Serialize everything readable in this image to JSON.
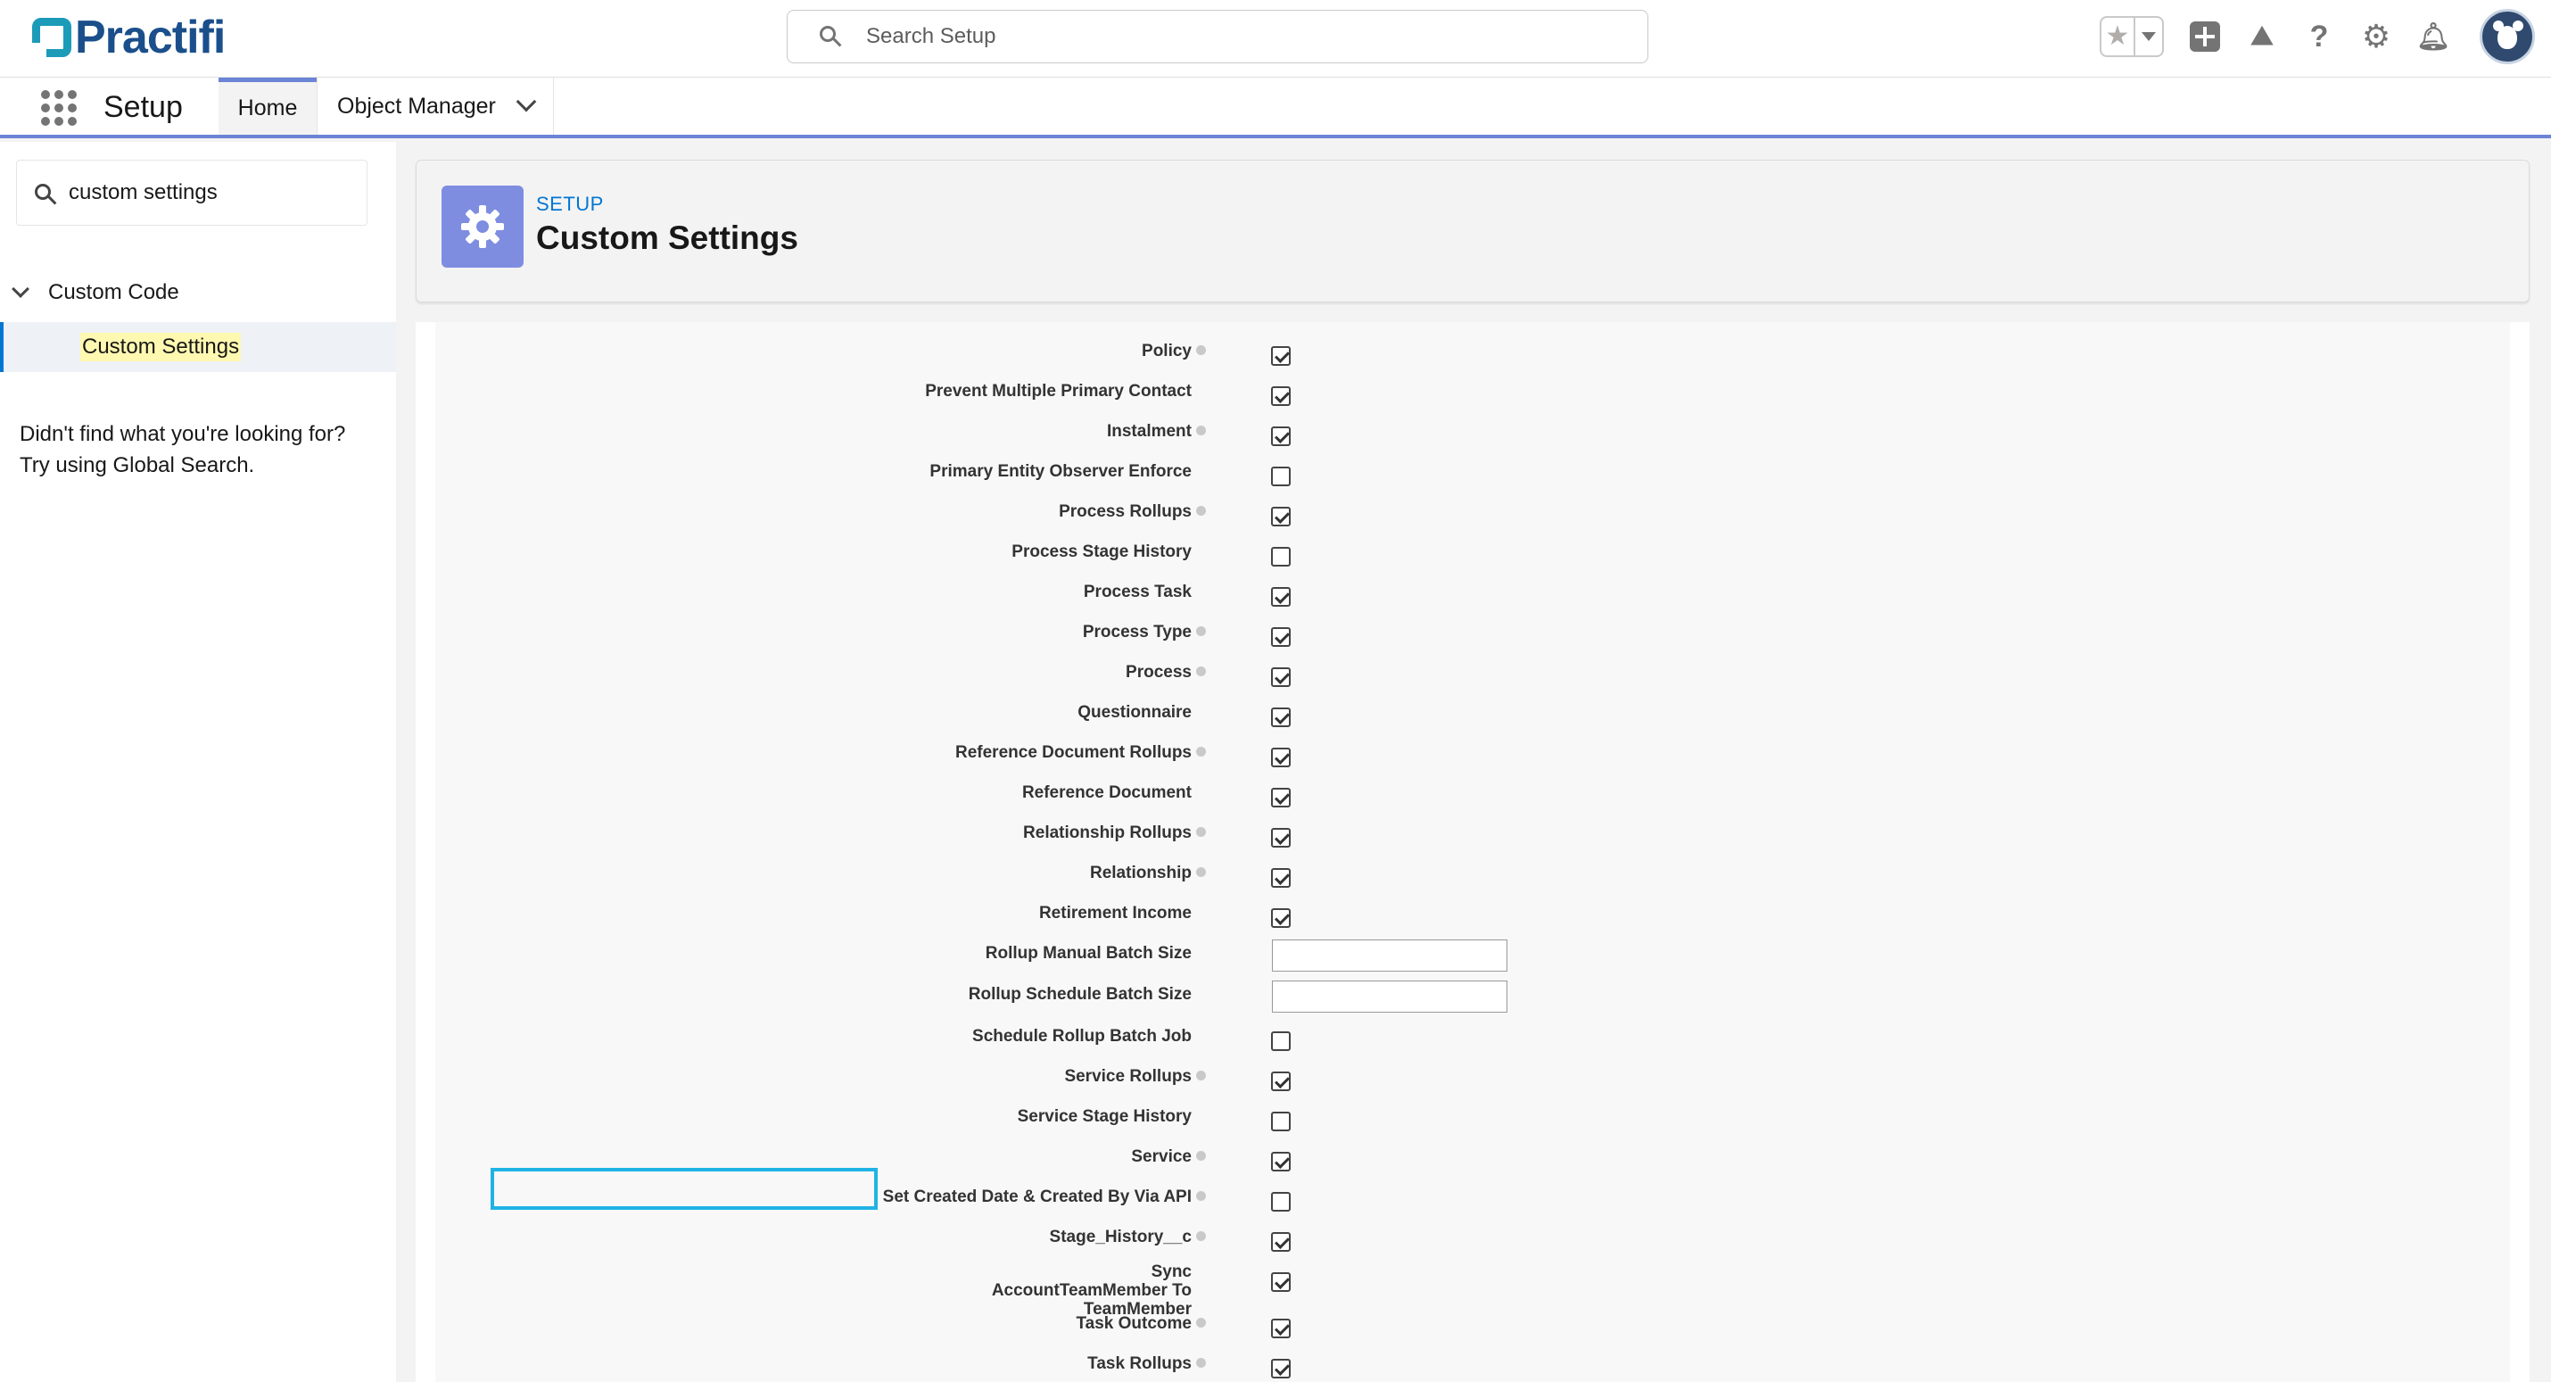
{
  "header": {
    "logo_text": "Practifi",
    "search_placeholder": "Search Setup"
  },
  "nav": {
    "app_name": "Setup",
    "tabs": [
      {
        "label": "Home",
        "active": true
      },
      {
        "label": "Object Manager",
        "active": false
      }
    ]
  },
  "sidebar": {
    "quick_find_value": "custom settings",
    "group_label": "Custom Code",
    "selected_item": "Custom Settings",
    "help_line1": "Didn't find what you're looking for?",
    "help_line2": "Try using Global Search."
  },
  "page_header": {
    "eyebrow": "SETUP",
    "title": "Custom Settings"
  },
  "fields": [
    {
      "label": "Policy",
      "help": true,
      "type": "checkbox",
      "checked": true
    },
    {
      "label": "Prevent Multiple Primary Contact",
      "help": false,
      "type": "checkbox",
      "checked": true
    },
    {
      "label": "Instalment",
      "help": true,
      "type": "checkbox",
      "checked": true
    },
    {
      "label": "Primary Entity Observer Enforce",
      "help": false,
      "type": "checkbox",
      "checked": false
    },
    {
      "label": "Process Rollups",
      "help": true,
      "type": "checkbox",
      "checked": true
    },
    {
      "label": "Process Stage History",
      "help": false,
      "type": "checkbox",
      "checked": false
    },
    {
      "label": "Process Task",
      "help": false,
      "type": "checkbox",
      "checked": true
    },
    {
      "label": "Process Type",
      "help": true,
      "type": "checkbox",
      "checked": true
    },
    {
      "label": "Process",
      "help": true,
      "type": "checkbox",
      "checked": true
    },
    {
      "label": "Questionnaire",
      "help": false,
      "type": "checkbox",
      "checked": true
    },
    {
      "label": "Reference Document Rollups",
      "help": true,
      "type": "checkbox",
      "checked": true
    },
    {
      "label": "Reference Document",
      "help": false,
      "type": "checkbox",
      "checked": true
    },
    {
      "label": "Relationship Rollups",
      "help": true,
      "type": "checkbox",
      "checked": true
    },
    {
      "label": "Relationship",
      "help": true,
      "type": "checkbox",
      "checked": true
    },
    {
      "label": "Retirement Income",
      "help": false,
      "type": "checkbox",
      "checked": true
    },
    {
      "label": "Rollup Manual Batch Size",
      "help": false,
      "type": "text",
      "value": ""
    },
    {
      "label": "Rollup Schedule Batch Size",
      "help": false,
      "type": "text",
      "value": ""
    },
    {
      "label": "Schedule Rollup Batch Job",
      "help": false,
      "type": "checkbox",
      "checked": false
    },
    {
      "label": "Service Rollups",
      "help": true,
      "type": "checkbox",
      "checked": true
    },
    {
      "label": "Service Stage History",
      "help": false,
      "type": "checkbox",
      "checked": false
    },
    {
      "label": "Service",
      "help": true,
      "type": "checkbox",
      "checked": true
    },
    {
      "label": "Set Created Date & Created By Via API",
      "help": true,
      "type": "checkbox",
      "checked": false,
      "highlighted": true
    },
    {
      "label": "Stage_History__c",
      "help": true,
      "type": "checkbox",
      "checked": true
    },
    {
      "label": "Sync AccountTeamMember To TeamMember",
      "help": false,
      "type": "checkbox",
      "checked": true,
      "multiline": true
    },
    {
      "label": "Task Outcome",
      "help": true,
      "type": "checkbox",
      "checked": true
    },
    {
      "label": "Task Rollups",
      "help": true,
      "type": "checkbox",
      "checked": true
    }
  ],
  "colors": {
    "brand_blue": "#0176d3",
    "nav_underline": "#6b84d6",
    "setup_icon_bg": "#7f8de1",
    "highlight_border": "#1fb3e5"
  },
  "icons": [
    "search-icon",
    "star-icon",
    "add-icon",
    "trailhead-icon",
    "help-icon",
    "gear-icon",
    "bell-icon",
    "avatar",
    "app-launcher-icon",
    "chevron-down-icon"
  ]
}
